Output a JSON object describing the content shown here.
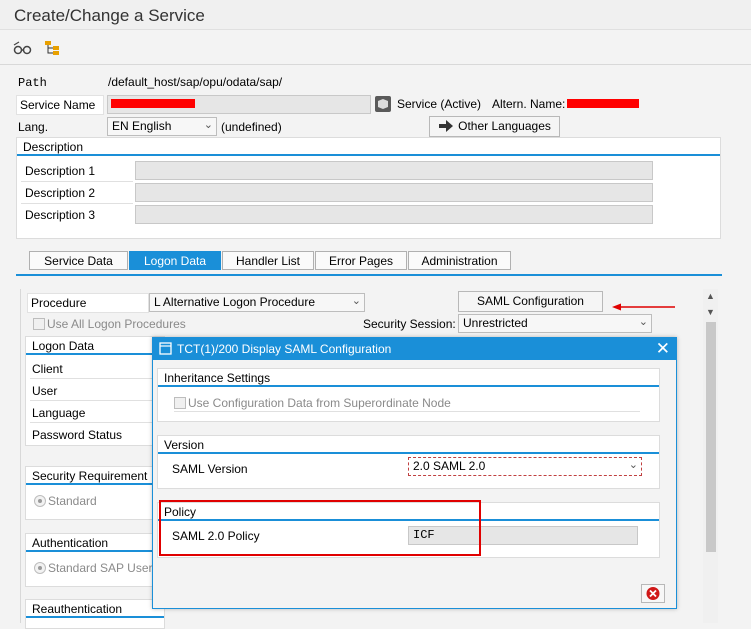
{
  "window": {
    "title": "Create/Change a Service"
  },
  "toolbar": {
    "display_icon": "glasses-icon",
    "hierarchy_icon": "hierarchy-icon"
  },
  "header": {
    "path_label": "Path",
    "path_value": "/default_host/sap/opu/odata/sap/",
    "service_name_label": "Service Name",
    "service_status": "Service (Active)",
    "altern_name_label": "Altern. Name:",
    "lang_label": "Lang.",
    "lang_value": "EN English",
    "lang_undefined": "(undefined)",
    "other_languages_button": "Other Languages"
  },
  "description": {
    "title": "Description",
    "rows": [
      "Description 1",
      "Description 2",
      "Description 3"
    ]
  },
  "tabs": [
    "Service Data",
    "Logon Data",
    "Handler List",
    "Error Pages",
    "Administration"
  ],
  "logon": {
    "procedure_label": "Procedure",
    "procedure_value": "L Alternative Logon Procedure",
    "saml_button": "SAML Configuration",
    "use_all_label": "Use All Logon Procedures",
    "security_session_label": "Security Session:",
    "security_session_value": "Unrestricted",
    "logon_data_title": "Logon Data",
    "fields": [
      "Client",
      "User",
      "Language",
      "Password Status"
    ],
    "security_req_title": "Security Requirement",
    "standard_label": "Standard",
    "authentication_title": "Authentication",
    "standard_sap_user_label": "Standard SAP User",
    "reauth_title": "Reauthentication"
  },
  "dialog": {
    "title": "TCT(1)/200 Display SAML Configuration",
    "inheritance_title": "Inheritance Settings",
    "use_config_label": "Use Configuration Data from Superordinate Node",
    "version_title": "Version",
    "saml_version_label": "SAML Version",
    "saml_version_value": "2.0 SAML 2.0",
    "policy_title": "Policy",
    "saml_policy_label": "SAML 2.0 Policy",
    "saml_policy_value": "ICF"
  },
  "colors": {
    "accent": "#1a8fd8",
    "annotation": "#e00000"
  }
}
